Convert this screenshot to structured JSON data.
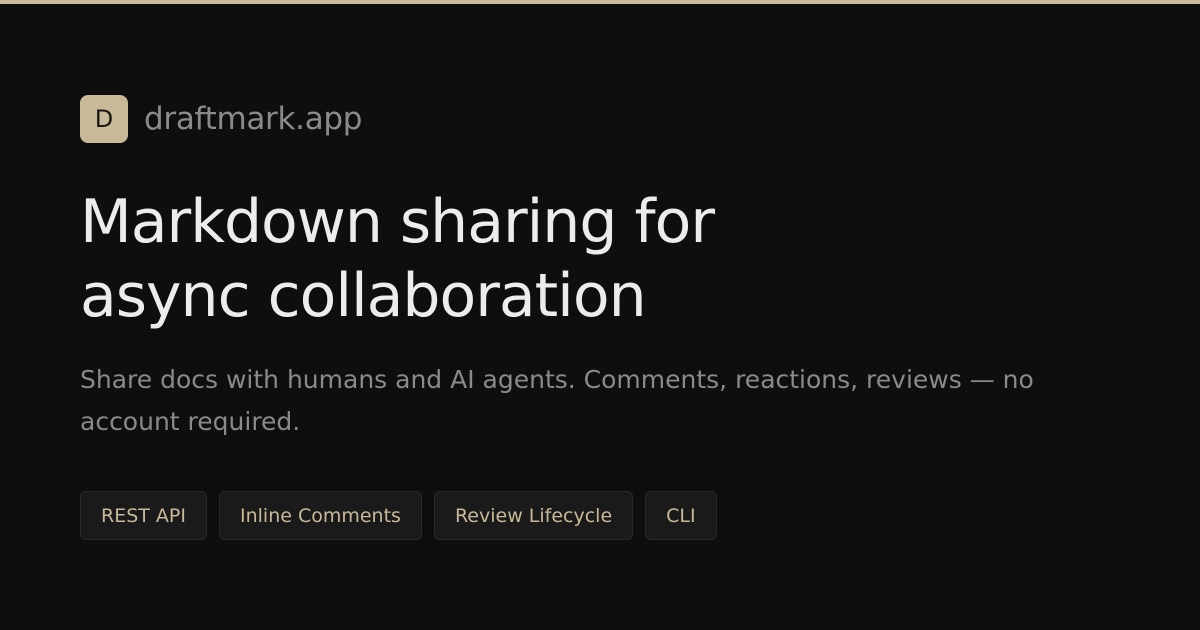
{
  "brand": {
    "logo_letter": "D",
    "name": "draftmark.app"
  },
  "headline": {
    "line1": "Markdown sharing for",
    "line2": "async collaboration"
  },
  "subtitle": "Share docs with humans and AI agents. Comments, reactions, reviews — no account required.",
  "tags": [
    {
      "label": "REST API"
    },
    {
      "label": "Inline Comments"
    },
    {
      "label": "Review Lifecycle"
    },
    {
      "label": "CLI"
    }
  ],
  "colors": {
    "background": "#0e0e0e",
    "accent": "#c8b998",
    "headline": "#ececea",
    "muted": "#8a8a8a"
  }
}
